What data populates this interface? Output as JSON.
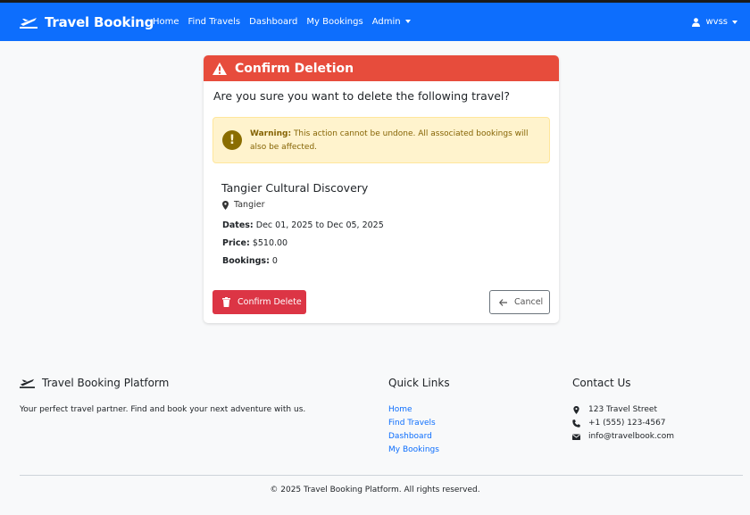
{
  "navbar": {
    "brand": "Travel Booking",
    "links": [
      "Home",
      "Find Travels",
      "Dashboard",
      "My Bookings"
    ],
    "admin": "Admin",
    "user": "wvss",
    "color": "#0d6efd"
  },
  "card": {
    "title": "Confirm Deletion",
    "question": "Are you sure you want to delete the following travel?",
    "warning_label": "Warning:",
    "warning_text": "This action cannot be undone. All associated bookings will also be affected.",
    "travel": {
      "name": "Tangier Cultural Discovery",
      "location": "Tangier",
      "dates_label": "Dates:",
      "dates": "Dec 01, 2025 to Dec 05, 2025",
      "price_label": "Price:",
      "price": "$510.00",
      "bookings_label": "Bookings:",
      "bookings": "0"
    },
    "confirm_button": "Confirm Delete",
    "cancel_button": "Cancel",
    "header_color": "#e74c3c"
  },
  "footer": {
    "brand": "Travel Booking Platform",
    "description": "Your perfect travel partner. Find and book your next adventure with us.",
    "quick_links_title": "Quick Links",
    "quick_links": [
      "Home",
      "Find Travels",
      "Dashboard",
      "My Bookings"
    ],
    "contact_title": "Contact Us",
    "address": "123 Travel Street",
    "phone": "+1 (555) 123-4567",
    "email": "info@travelbook.com",
    "copyright": "© 2025 Travel Booking Platform. All rights reserved."
  },
  "icons": [
    "plane-icon",
    "user-icon",
    "warning-icon",
    "exclamation-icon",
    "map-marker-icon",
    "trash-icon",
    "arrow-left-icon",
    "phone-icon",
    "envelope-icon"
  ]
}
